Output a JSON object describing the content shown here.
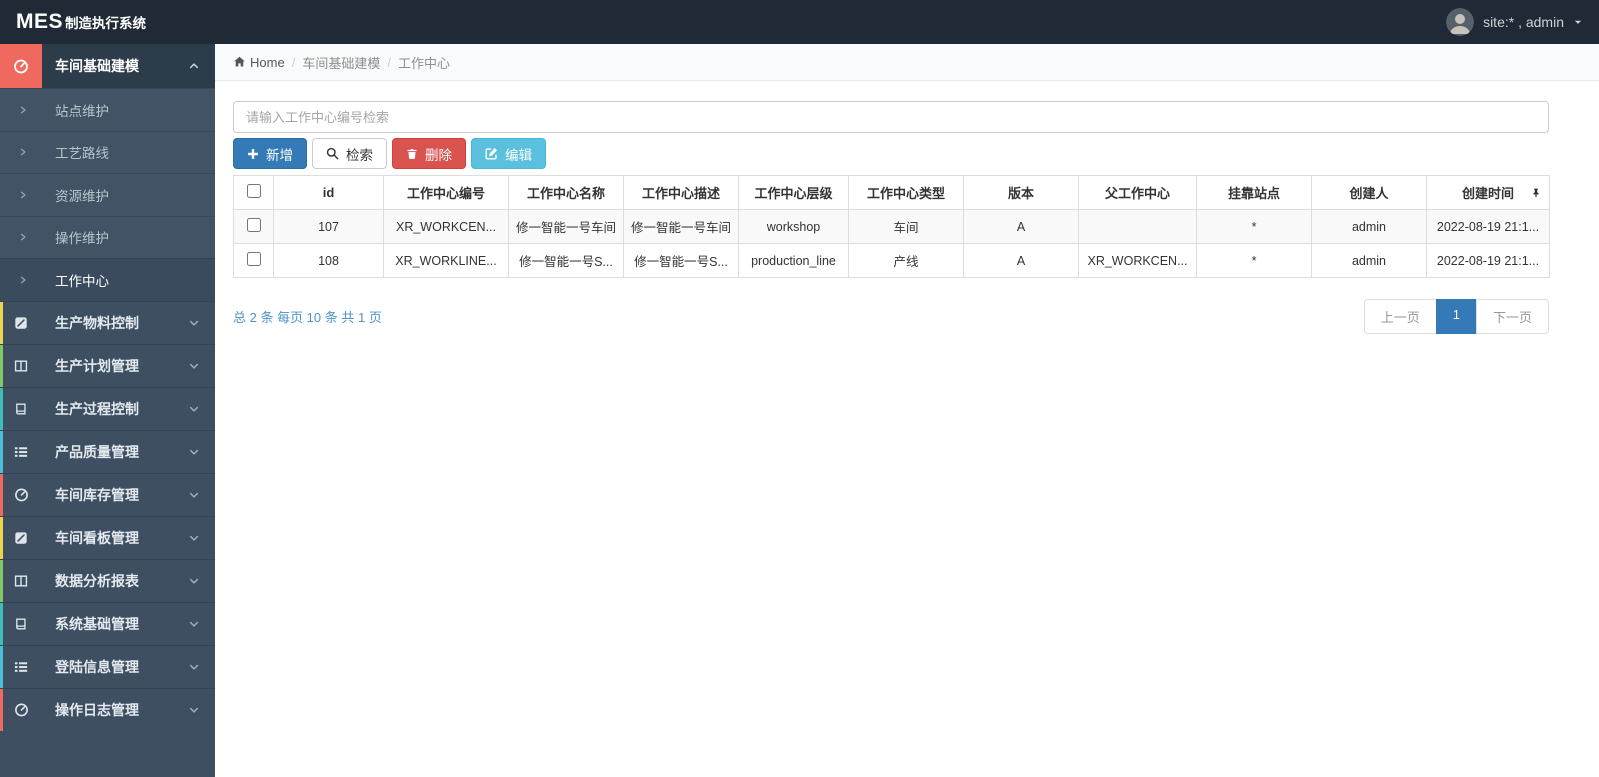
{
  "navbar": {
    "logo_big": "MES",
    "logo_small": "制造执行系统",
    "user_label": "site:* , admin"
  },
  "sidebar": {
    "items": [
      {
        "label": "车间基础建模",
        "icon": "tachometer-icon",
        "accent": "#f0695f",
        "expanded": true,
        "children": [
          {
            "label": "站点维护"
          },
          {
            "label": "工艺路线"
          },
          {
            "label": "资源维护"
          },
          {
            "label": "操作维护"
          },
          {
            "label": "工作中心",
            "active": true
          }
        ]
      },
      {
        "label": "生产物料控制",
        "icon": "pencil-square-icon",
        "accent": "#eed34f"
      },
      {
        "label": "生产计划管理",
        "icon": "columns-icon",
        "accent": "#82c766"
      },
      {
        "label": "生产过程控制",
        "icon": "book-icon",
        "accent": "#3cbfb4"
      },
      {
        "label": "产品质量管理",
        "icon": "list-icon",
        "accent": "#4bc0d9"
      },
      {
        "label": "车间库存管理",
        "icon": "tachometer-icon",
        "accent": "#f0695f"
      },
      {
        "label": "车间看板管理",
        "icon": "pencil-square-icon",
        "accent": "#eed34f"
      },
      {
        "label": "数据分析报表",
        "icon": "columns-icon",
        "accent": "#82c766"
      },
      {
        "label": "系统基础管理",
        "icon": "book-icon",
        "accent": "#3cbfb4"
      },
      {
        "label": "登陆信息管理",
        "icon": "list-icon",
        "accent": "#4bc0d9"
      },
      {
        "label": "操作日志管理",
        "icon": "tachometer-icon",
        "accent": "#f0695f"
      }
    ]
  },
  "breadcrumb": {
    "home": "Home",
    "level2": "车间基础建模",
    "level3": "工作中心"
  },
  "toolbar": {
    "search_placeholder": "请输入工作中心编号检索",
    "add_label": "新增",
    "search_label": "检索",
    "delete_label": "删除",
    "edit_label": "编辑",
    "colors": {
      "add": "#337ab7",
      "search": "#ffffff",
      "delete": "#d9534f",
      "edit": "#5bc0de"
    }
  },
  "table": {
    "columns": [
      "id",
      "工作中心编号",
      "工作中心名称",
      "工作中心描述",
      "工作中心层级",
      "工作中心类型",
      "版本",
      "父工作中心",
      "挂靠站点",
      "创建人",
      "创建时间"
    ],
    "rows": [
      [
        "107",
        "XR_WORKCEN...",
        "修一智能一号车间",
        "修一智能一号车间",
        "workshop",
        "车间",
        "A",
        "",
        "*",
        "admin",
        "2022-08-19 21:1..."
      ],
      [
        "108",
        "XR_WORKLINE...",
        "修一智能一号S...",
        "修一智能一号S...",
        "production_line",
        "产线",
        "A",
        "XR_WORKCEN...",
        "*",
        "admin",
        "2022-08-19 21:1..."
      ]
    ]
  },
  "pagination": {
    "summary": "总 2 条 每页 10 条 共 1 页",
    "prev_label": "上一页",
    "current_page": "1",
    "next_label": "下一页",
    "active_color": "#337ab7"
  }
}
